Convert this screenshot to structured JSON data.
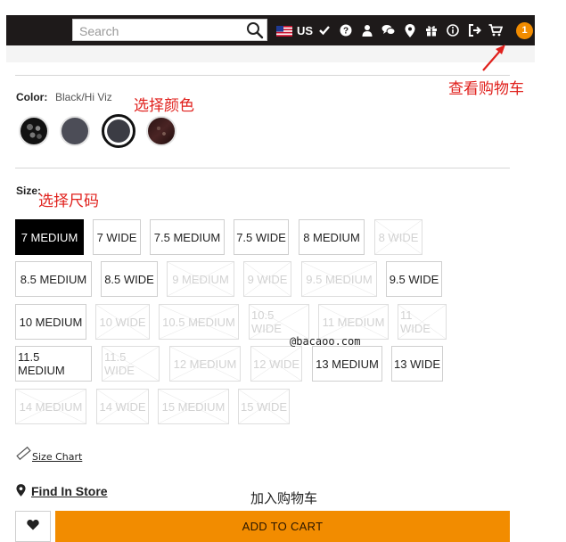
{
  "header": {
    "search_placeholder": "Search",
    "country": "US",
    "cart_count": "1"
  },
  "annotations": {
    "view_cart": "查看购物车",
    "select_color": "选择颜色",
    "select_size": "选择尺码",
    "add_to_cart": "加入购物车"
  },
  "color": {
    "label": "Color:",
    "selected": "Black/Hi Viz"
  },
  "size": {
    "label": "Size:",
    "options": [
      {
        "label": "7 MEDIUM",
        "state": "selected"
      },
      {
        "label": "7 WIDE",
        "state": "available"
      },
      {
        "label": "7.5 MEDIUM",
        "state": "available"
      },
      {
        "label": "7.5 WIDE",
        "state": "available"
      },
      {
        "label": "8 MEDIUM",
        "state": "available"
      },
      {
        "label": "8 WIDE",
        "state": "unavailable"
      },
      {
        "label": "8.5 MEDIUM",
        "state": "available"
      },
      {
        "label": "8.5 WIDE",
        "state": "available"
      },
      {
        "label": "9 MEDIUM",
        "state": "unavailable"
      },
      {
        "label": "9 WIDE",
        "state": "unavailable"
      },
      {
        "label": "9.5 MEDIUM",
        "state": "unavailable"
      },
      {
        "label": "9.5 WIDE",
        "state": "available"
      },
      {
        "label": "10 MEDIUM",
        "state": "available"
      },
      {
        "label": "10 WIDE",
        "state": "unavailable"
      },
      {
        "label": "10.5 MEDIUM",
        "state": "unavailable"
      },
      {
        "label": "10.5 WIDE",
        "state": "unavailable"
      },
      {
        "label": "11 MEDIUM",
        "state": "unavailable"
      },
      {
        "label": "11 WIDE",
        "state": "unavailable"
      },
      {
        "label": "11.5 MEDIUM",
        "state": "available"
      },
      {
        "label": "11.5 WIDE",
        "state": "unavailable"
      },
      {
        "label": "12 MEDIUM",
        "state": "unavailable"
      },
      {
        "label": "12 WIDE",
        "state": "unavailable"
      },
      {
        "label": "13 MEDIUM",
        "state": "available"
      },
      {
        "label": "13 WIDE",
        "state": "available"
      },
      {
        "label": "14 MEDIUM",
        "state": "unavailable"
      },
      {
        "label": "14 WIDE",
        "state": "unavailable"
      },
      {
        "label": "15 MEDIUM",
        "state": "unavailable"
      },
      {
        "label": "15 WIDE",
        "state": "unavailable"
      }
    ]
  },
  "links": {
    "size_chart": "Size Chart",
    "find_in_store": "Find In Store"
  },
  "watermark": "@bacaoo.com",
  "actions": {
    "add_to_cart": "ADD TO CART"
  },
  "colors": {
    "accent": "#f28c00",
    "annotation": "#e0201c",
    "topbar": "#1e1a1a"
  }
}
